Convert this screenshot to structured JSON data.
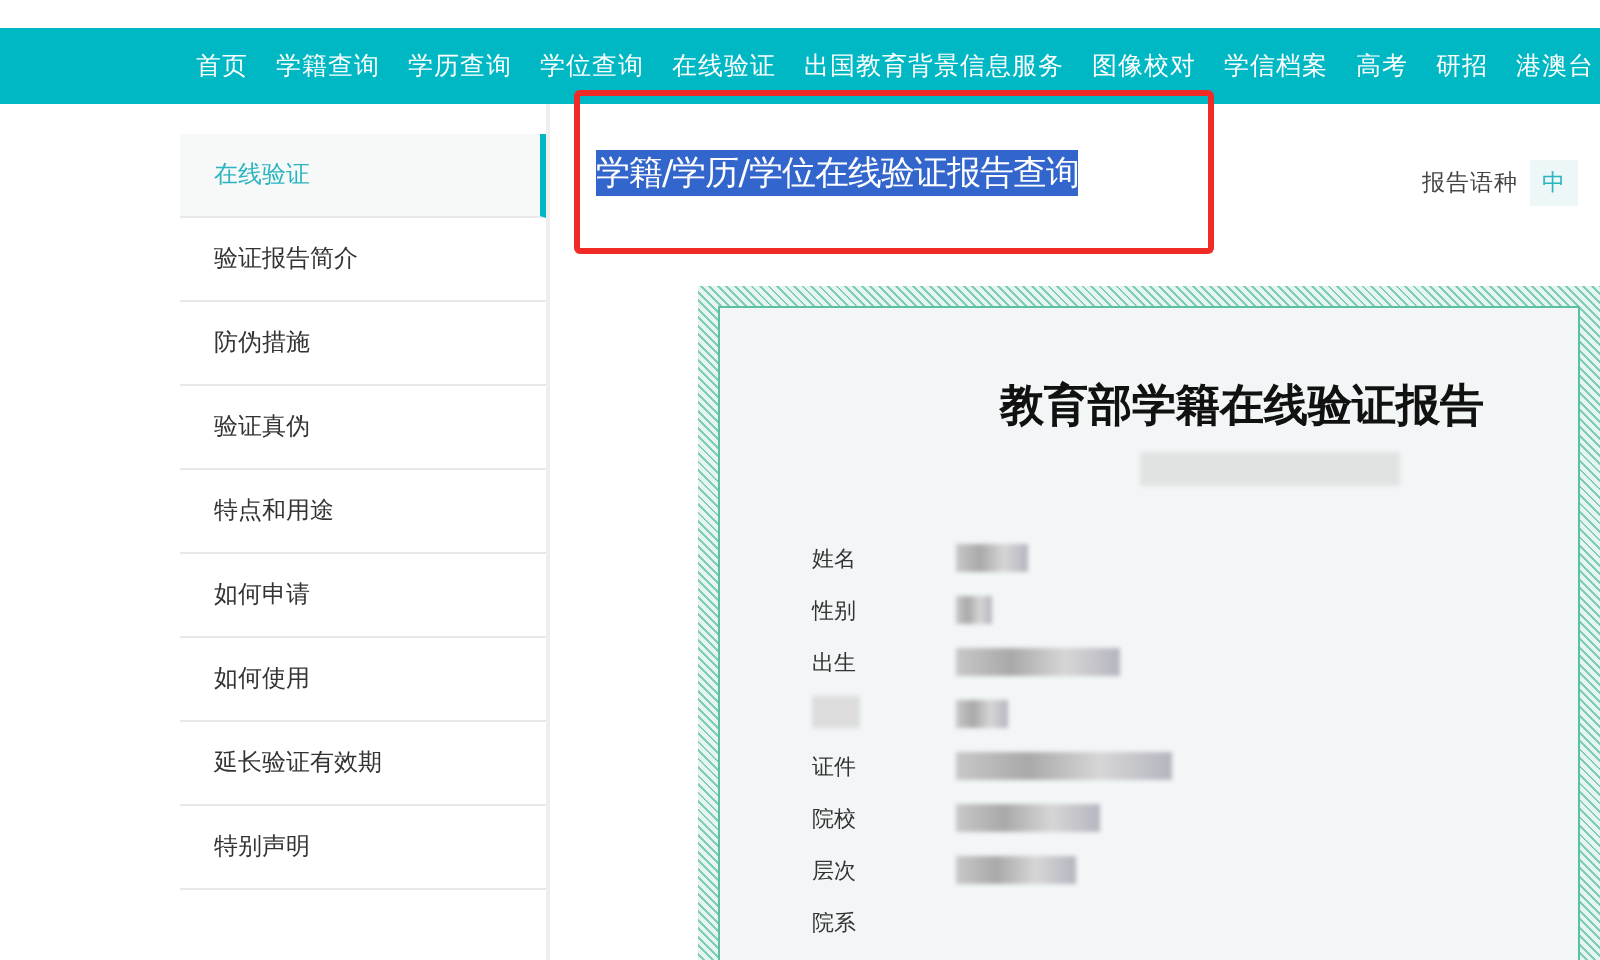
{
  "nav": {
    "items": [
      {
        "label": "首页"
      },
      {
        "label": "学籍查询"
      },
      {
        "label": "学历查询"
      },
      {
        "label": "学位查询"
      },
      {
        "label": "在线验证"
      },
      {
        "label": "出国教育背景信息服务"
      },
      {
        "label": "图像校对"
      },
      {
        "label": "学信档案"
      },
      {
        "label": "高考"
      },
      {
        "label": "研招"
      },
      {
        "label": "港澳台"
      }
    ]
  },
  "sidebar": {
    "items": [
      {
        "label": "在线验证",
        "selected": true
      },
      {
        "label": "验证报告简介",
        "selected": false
      },
      {
        "label": "防伪措施",
        "selected": false
      },
      {
        "label": "验证真伪",
        "selected": false
      },
      {
        "label": "特点和用途",
        "selected": false
      },
      {
        "label": "如何申请",
        "selected": false
      },
      {
        "label": "如何使用",
        "selected": false
      },
      {
        "label": "延长验证有效期",
        "selected": false
      },
      {
        "label": "特别声明",
        "selected": false
      }
    ]
  },
  "page_title": "学籍/学历/学位在线验证报告查询",
  "language": {
    "label": "报告语种",
    "value": "中"
  },
  "report": {
    "title": "教育部学籍在线验证报告",
    "fields": [
      {
        "kind": "text",
        "label": "姓名",
        "value_blurred": true
      },
      {
        "kind": "text",
        "label": "性别",
        "value_blurred": true
      },
      {
        "kind": "text",
        "label": "出生",
        "value_blurred": true
      },
      {
        "kind": "blurred",
        "value_blurred": true
      },
      {
        "kind": "text",
        "label": "证件",
        "value_blurred": true
      },
      {
        "kind": "text",
        "label": "院校",
        "value_blurred": true
      },
      {
        "kind": "text",
        "label": "层次",
        "value_blurred": true
      },
      {
        "kind": "text",
        "label": "院系",
        "value_blurred": false
      }
    ]
  }
}
